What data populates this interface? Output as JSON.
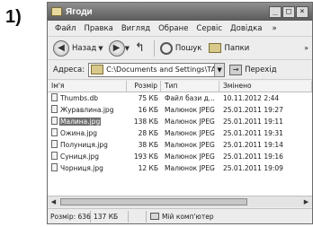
{
  "step_number": "1)",
  "window": {
    "title": "Ягоди"
  },
  "menu": [
    "Файл",
    "Правка",
    "Вигляд",
    "Обране",
    "Сервіс",
    "Довідка"
  ],
  "menu_overflow": "»",
  "toolbar": {
    "back_label": "Назад",
    "search_label": "Пошук",
    "folders_label": "Папки",
    "more": "»"
  },
  "address": {
    "label": "Адреса:",
    "path": "C:\\Documents and Settings\\TANYA\\",
    "go_label": "Перехід"
  },
  "columns": {
    "name": "Ім'я",
    "size": "Розмір",
    "type": "Тип",
    "date": "Змінено"
  },
  "files": [
    {
      "name": "Thumbs.db",
      "size": "75 КБ",
      "type": "Файл бази д...",
      "date": "10.11.2012 2:44",
      "selected": false
    },
    {
      "name": "Журавлина.jpg",
      "size": "16 КБ",
      "type": "Малюнок JPEG",
      "date": "25.01.2011 19:27",
      "selected": false
    },
    {
      "name": "Малина.jpg",
      "size": "138 КБ",
      "type": "Малюнок JPEG",
      "date": "25.01.2011 19:11",
      "selected": true
    },
    {
      "name": "Ожина.jpg",
      "size": "28 КБ",
      "type": "Малюнок JPEG",
      "date": "25.01.2011 19:31",
      "selected": false
    },
    {
      "name": "Полуниця.jpg",
      "size": "38 КБ",
      "type": "Малюнок JPEG",
      "date": "25.01.2011 19:14",
      "selected": false
    },
    {
      "name": "Суниця.jpg",
      "size": "193 КБ",
      "type": "Малюнок JPEG",
      "date": "25.01.2011 19:16",
      "selected": false
    },
    {
      "name": "Чорниця.jpg",
      "size": "12 КБ",
      "type": "Малюнок JPEG",
      "date": "25.01.2011 19:09",
      "selected": false
    }
  ],
  "status": {
    "count": "Розмір: 636",
    "size": "137 КБ",
    "location": "Мій комп'ютер"
  },
  "colors": {
    "titlebar": "#5a5a5a",
    "selection": "#6d6d6d"
  },
  "icons": {
    "back": "back-arrow-icon",
    "forward": "forward-arrow-icon",
    "up": "folder-up-icon",
    "search": "search-icon",
    "folders": "folders-icon"
  }
}
